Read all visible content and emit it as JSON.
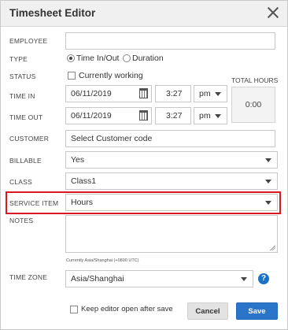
{
  "dialog": {
    "title": "Timesheet Editor"
  },
  "employee": {
    "label": "EMPLOYEE",
    "value": ""
  },
  "type": {
    "label": "TYPE",
    "options": [
      "Time In/Out",
      "Duration"
    ],
    "selected": "Time In/Out"
  },
  "status": {
    "label": "STATUS",
    "checkbox_label": "Currently working",
    "checked": false
  },
  "time_in": {
    "label": "TIME IN",
    "date": "06/11/2019",
    "time": "3:27",
    "ampm": "pm"
  },
  "time_out": {
    "label": "TIME OUT",
    "date": "06/11/2019",
    "time": "3:27",
    "ampm": "pm"
  },
  "total_hours": {
    "label": "TOTAL HOURS",
    "value": "0:00"
  },
  "customer": {
    "label": "CUSTOMER",
    "placeholder": "Select Customer code"
  },
  "billable": {
    "label": "BILLABLE",
    "value": "Yes"
  },
  "class": {
    "label": "CLASS",
    "value": "Class1"
  },
  "service_item": {
    "label": "SERVICE ITEM",
    "value": "Hours"
  },
  "notes": {
    "label": "NOTES",
    "value": ""
  },
  "timezone": {
    "label": "TIME ZONE",
    "current_note": "Currently Asia/Shanghai (+0800 UTC)",
    "value": "Asia/Shanghai"
  },
  "footer": {
    "keep_open_label": "Keep editor open after save",
    "cancel_label": "Cancel",
    "save_label": "Save"
  },
  "colors": {
    "highlight": "#d9191f",
    "primary": "#2a74c9",
    "help_icon": "#1a73c6"
  }
}
